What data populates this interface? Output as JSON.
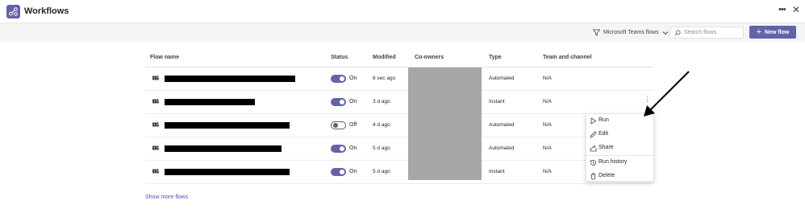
{
  "app": {
    "title": "Workflows",
    "accent": "#6264a7"
  },
  "toolbar": {
    "filter_label": "Microsoft Teams flows",
    "search_placeholder": "Search flows",
    "new_flow_label": "New flow"
  },
  "table": {
    "headers": {
      "flow_name": "Flow name",
      "status": "Status",
      "modified": "Modified",
      "coowners": "Co-owners",
      "type": "Type",
      "team_channel": "Team and channel"
    },
    "rows": [
      {
        "status": "On",
        "on": true,
        "modified": "8 sec ago",
        "type": "Automated",
        "team": "N/A"
      },
      {
        "status": "On",
        "on": true,
        "modified": "3 d ago",
        "type": "Instant",
        "team": "N/A"
      },
      {
        "status": "Off",
        "on": false,
        "modified": "4 d ago",
        "type": "Automated",
        "team": "N/A"
      },
      {
        "status": "On",
        "on": true,
        "modified": "5 d ago",
        "type": "Automated",
        "team": "N/A"
      },
      {
        "status": "On",
        "on": true,
        "modified": "5 d ago",
        "type": "Instant",
        "team": "N/A"
      }
    ],
    "show_more": "Show more flows"
  },
  "context_menu": {
    "items": [
      {
        "label": "Run",
        "icon": "play-icon"
      },
      {
        "label": "Edit",
        "icon": "pencil-icon"
      },
      {
        "label": "Share",
        "icon": "share-icon"
      },
      {
        "label": "Run history",
        "icon": "history-icon"
      },
      {
        "label": "Delete",
        "icon": "trash-icon"
      }
    ]
  }
}
